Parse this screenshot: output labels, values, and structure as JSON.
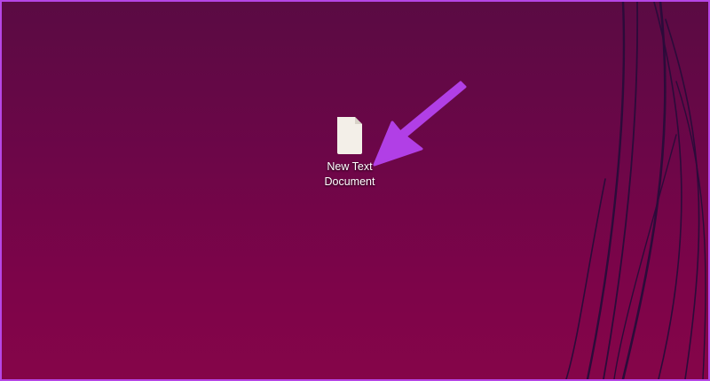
{
  "desktop": {
    "icons": [
      {
        "label": "New Text Document",
        "icon": "text-file-icon"
      }
    ]
  },
  "annotation": {
    "icon": "arrow-pointer-icon",
    "color": "#b13fe6"
  },
  "colors": {
    "frame": "#b646e6",
    "wallpaper_top": "#5a0b43",
    "wallpaper_bottom": "#850549",
    "line": "#2b0b3a"
  }
}
